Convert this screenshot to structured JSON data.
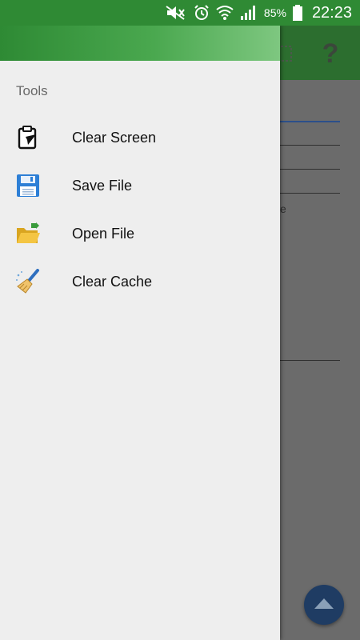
{
  "status_bar": {
    "battery": "85%",
    "time": "22:23",
    "color": "#2f8a34"
  },
  "background": {
    "toolbar_color": "#2c6e2f",
    "help_label": "?",
    "partial_letter": "e",
    "fab_icon": "chevron-up-icon"
  },
  "drawer": {
    "header_color": "#4aa84f",
    "section_title": "Tools",
    "items": [
      {
        "label": "Clear Screen",
        "icon": "clipboard-icon"
      },
      {
        "label": "Save File",
        "icon": "floppy-disk-icon"
      },
      {
        "label": "Open File",
        "icon": "open-folder-icon"
      },
      {
        "label": "Clear Cache",
        "icon": "broom-icon"
      }
    ]
  }
}
